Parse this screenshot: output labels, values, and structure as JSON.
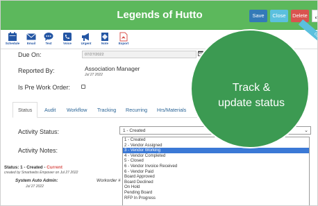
{
  "header": {
    "title": "Legends of Hutto",
    "save_label": "Save",
    "close_label": "Close",
    "delete_label": "Delete",
    "expand_icon": "expand-icon"
  },
  "toolbar": {
    "items": [
      {
        "label": "Schedule",
        "icon": "calendar-icon"
      },
      {
        "label": "Email",
        "icon": "envelope-icon"
      },
      {
        "label": "Text",
        "icon": "chat-icon"
      },
      {
        "label": "Voice",
        "icon": "phone-icon"
      },
      {
        "label": "Urgent",
        "icon": "megaphone-icon"
      },
      {
        "label": "Note",
        "icon": "note-icon"
      },
      {
        "label": "Export",
        "icon": "pdf-icon"
      }
    ],
    "accent": "#2456a4"
  },
  "ribbon": {
    "label": "Op"
  },
  "form": {
    "due_on_label": "Due On:",
    "due_on_value": "07/27/2022",
    "reported_by_label": "Reported By:",
    "reported_by_name": "Association Manager",
    "reported_by_date": "Jul 27 2022",
    "pre_work_order_label": "Is Pre Work Order:",
    "pre_work_order_checked": false
  },
  "tabs": [
    {
      "label": "Status",
      "active": true
    },
    {
      "label": "Audit",
      "active": false
    },
    {
      "label": "Workflow",
      "active": false
    },
    {
      "label": "Tracking",
      "active": false
    },
    {
      "label": "Recurring",
      "active": false
    },
    {
      "label": "Hrs/Materials",
      "active": false
    }
  ],
  "activity": {
    "status_label": "Activity Status:",
    "selected": "1 - Created",
    "notes_label": "Activity Notes:",
    "options": [
      "1 - Created",
      "2 - Vendor Assigned",
      "3 - Vendor Working",
      "4 - Vendor Completed",
      "5 - Closed",
      "6 - Vendor Invoice Received",
      "6 - Vendor Paid",
      "Board Approved",
      "Board Declined",
      "On Hold",
      "Pending Board",
      "RFP In Progress"
    ],
    "highlighted_index": 2
  },
  "status_history": {
    "status_prefix": "Status: 1 - Created - ",
    "current_tag": "Current",
    "created_by": "created by Smartwebs Empower on Jul 27 2022",
    "admin_name": "System Auto Admin:",
    "admin_date": "Jul 27 2022",
    "workorder_text": "Workorder #"
  },
  "overlay": {
    "line1": "Track &",
    "line2": "update status",
    "color": "#3c9a52"
  },
  "colors": {
    "header_green": "#5cb85c",
    "save_blue": "#337ab7",
    "close_cyan": "#5bc0de",
    "delete_red": "#d9534f",
    "highlight_blue": "#3b79d6"
  }
}
